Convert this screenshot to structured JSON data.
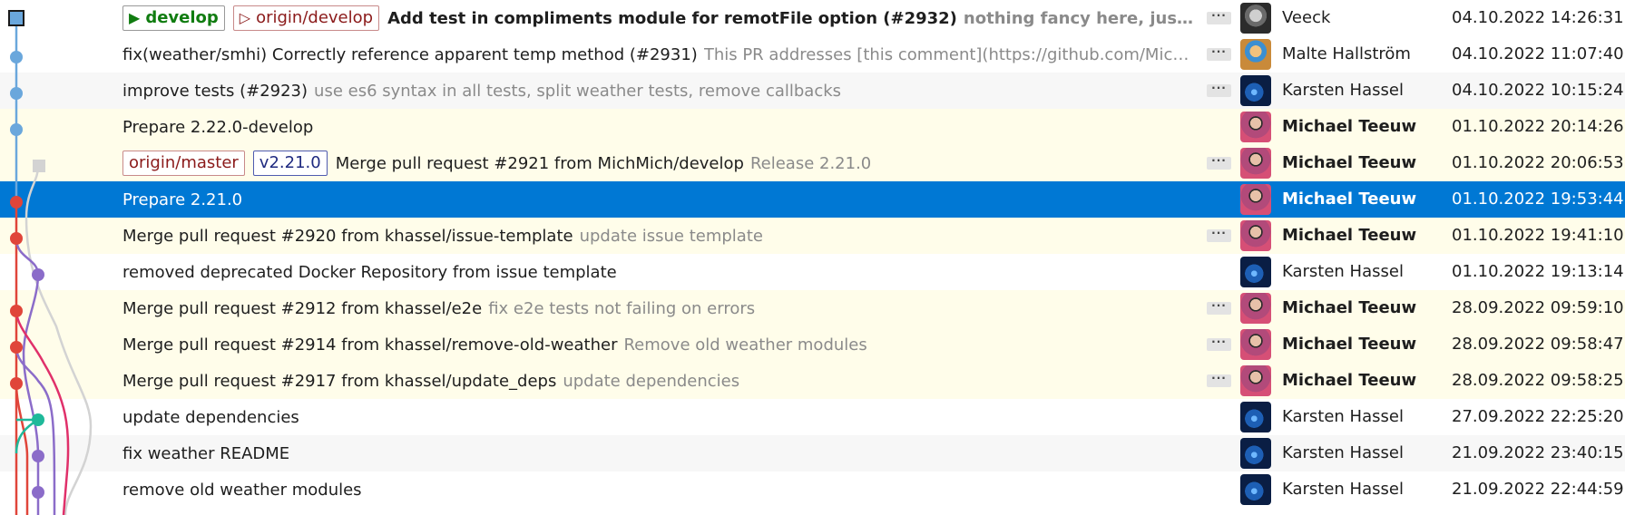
{
  "colors": {
    "selection": "#0078d4",
    "highlight_row": "#fffdea",
    "alt_row": "#f7f7f7",
    "lane_blue": "#6aa7dc",
    "lane_red": "#e0453a",
    "lane_grey": "#d3d3d3",
    "lane_purple": "#8b6cc9",
    "lane_magenta": "#e0306a",
    "lane_teal": "#1fb99a",
    "branch_local_text": "#107c10",
    "branch_remote_text": "#8b1a1a",
    "tag_text": "#1f2a80"
  },
  "commits": [
    {
      "refs": [
        {
          "label": "develop",
          "kind": "branch-local",
          "icon": "play-triangle-icon"
        },
        {
          "label": "origin/develop",
          "kind": "branch-remote",
          "icon": "outline-triangle-icon"
        }
      ],
      "subject": "Add test in compliments module for remotFile option (#2932)",
      "body": "nothing fancy here, just a simple test after ...",
      "bold": true,
      "has_more": true,
      "author": "Veeck",
      "author_bold": false,
      "avatar": "veeck",
      "date": "04.10.2022 14:26:31",
      "row_style": "plain"
    },
    {
      "refs": [],
      "subject": "fix(weather/smhi) Correctly reference apparent temp method (#2931)",
      "body": "This PR addresses [this comment](https://github.com/MichMich/MagicMirror/c...",
      "bold": false,
      "has_more": true,
      "author": "Malte Hallström",
      "author_bold": false,
      "avatar": "malte",
      "date": "04.10.2022 11:07:40",
      "row_style": "plain"
    },
    {
      "refs": [],
      "subject": "improve tests (#2923)",
      "body": "use es6 syntax in all tests, split weather tests, remove callbacks",
      "bold": false,
      "has_more": true,
      "author": "Karsten Hassel",
      "author_bold": false,
      "avatar": "karsten",
      "date": "04.10.2022 10:15:24",
      "row_style": "alt"
    },
    {
      "refs": [],
      "subject": "Prepare 2.22.0-develop",
      "body": "",
      "bold": false,
      "has_more": false,
      "author": "Michael Teeuw",
      "author_bold": true,
      "avatar": "michael",
      "date": "01.10.2022 20:14:26",
      "row_style": "hl"
    },
    {
      "refs": [
        {
          "label": "origin/master",
          "kind": "branch-remote",
          "icon": ""
        },
        {
          "label": "v2.21.0",
          "kind": "tag",
          "icon": ""
        }
      ],
      "subject": "Merge pull request #2921 from MichMich/develop",
      "body": "Release 2.21.0",
      "bold": false,
      "has_more": true,
      "author": "Michael Teeuw",
      "author_bold": true,
      "avatar": "michael",
      "date": "01.10.2022 20:06:53",
      "row_style": "hl"
    },
    {
      "refs": [],
      "subject": "Prepare 2.21.0",
      "body": "",
      "bold": false,
      "has_more": false,
      "author": "Michael Teeuw",
      "author_bold": true,
      "avatar": "michael",
      "date": "01.10.2022 19:53:44",
      "row_style": "sel"
    },
    {
      "refs": [],
      "subject": "Merge pull request #2920 from khassel/issue-template",
      "body": "update issue template",
      "bold": false,
      "has_more": true,
      "author": "Michael Teeuw",
      "author_bold": true,
      "avatar": "michael",
      "date": "01.10.2022 19:41:10",
      "row_style": "hl"
    },
    {
      "refs": [],
      "subject": "removed deprecated Docker Repository from issue template",
      "body": "",
      "bold": false,
      "has_more": false,
      "author": "Karsten Hassel",
      "author_bold": false,
      "avatar": "karsten",
      "date": "01.10.2022 19:13:14",
      "row_style": "plain"
    },
    {
      "refs": [],
      "subject": "Merge pull request #2912 from khassel/e2e",
      "body": "fix e2e tests not failing on errors",
      "bold": false,
      "has_more": true,
      "author": "Michael Teeuw",
      "author_bold": true,
      "avatar": "michael",
      "date": "28.09.2022 09:59:10",
      "row_style": "hl"
    },
    {
      "refs": [],
      "subject": "Merge pull request #2914 from khassel/remove-old-weather",
      "body": "Remove old weather modules",
      "bold": false,
      "has_more": true,
      "author": "Michael Teeuw",
      "author_bold": true,
      "avatar": "michael",
      "date": "28.09.2022 09:58:47",
      "row_style": "hl"
    },
    {
      "refs": [],
      "subject": "Merge pull request #2917 from khassel/update_deps",
      "body": "update dependencies",
      "bold": false,
      "has_more": true,
      "author": "Michael Teeuw",
      "author_bold": true,
      "avatar": "michael",
      "date": "28.09.2022 09:58:25",
      "row_style": "hl"
    },
    {
      "refs": [],
      "subject": "update dependencies",
      "body": "",
      "bold": false,
      "has_more": false,
      "author": "Karsten Hassel",
      "author_bold": false,
      "avatar": "karsten",
      "date": "27.09.2022 22:25:20",
      "row_style": "plain"
    },
    {
      "refs": [],
      "subject": "fix weather README",
      "body": "",
      "bold": false,
      "has_more": false,
      "author": "Karsten Hassel",
      "author_bold": false,
      "avatar": "karsten",
      "date": "21.09.2022 23:40:15",
      "row_style": "alt"
    },
    {
      "refs": [],
      "subject": "remove old weather modules",
      "body": "",
      "bold": false,
      "has_more": false,
      "author": "Karsten Hassel",
      "author_bold": false,
      "avatar": "karsten",
      "date": "21.09.2022 22:44:59",
      "row_style": "plain"
    }
  ]
}
